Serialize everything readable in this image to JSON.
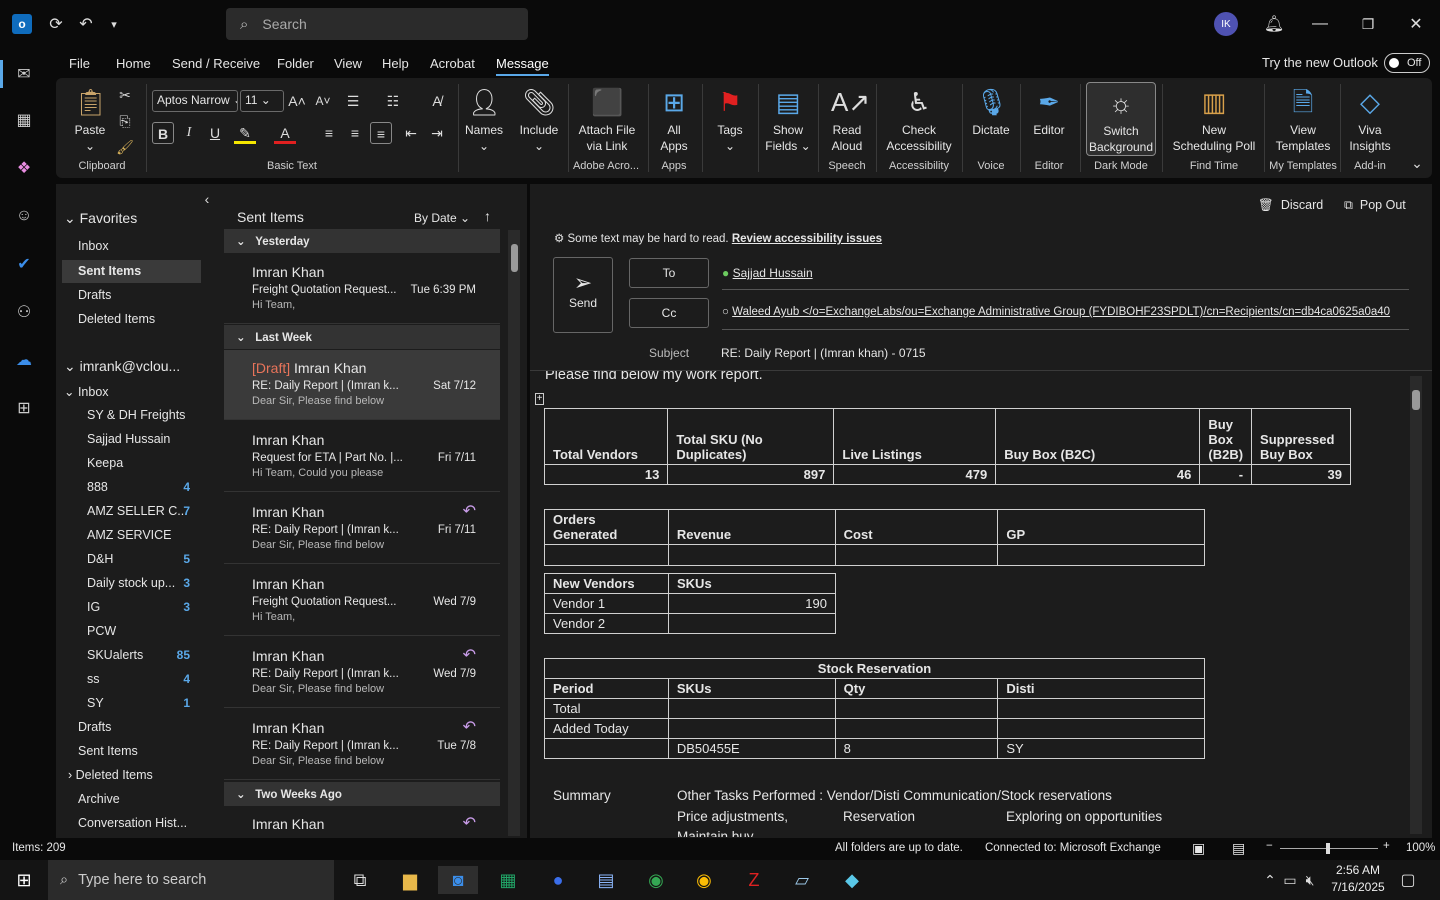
{
  "titlebar": {
    "search_placeholder": "Search",
    "avatar": "IK"
  },
  "menu": [
    "File",
    "Home",
    "Send / Receive",
    "Folder",
    "View",
    "Help",
    "Acrobat",
    "Message"
  ],
  "try_new": "Try the new Outlook",
  "toggle": "Off",
  "ribbon": {
    "paste": "Paste",
    "clipboard": "Clipboard",
    "font": "Aptos Narrow",
    "size": "11",
    "basic_text": "Basic Text",
    "names": "Names",
    "include": "Include",
    "attach1": "Attach File",
    "attach2": "via Link",
    "adobe": "Adobe Acro...",
    "allapps1": "All",
    "allapps2": "Apps",
    "apps": "Apps",
    "tags": "Tags",
    "showfields1": "Show",
    "showfields2": "Fields",
    "read1": "Read",
    "read2": "Aloud",
    "speech": "Speech",
    "check1": "Check",
    "check2": "Accessibility",
    "accessibility": "Accessibility",
    "dictate": "Dictate",
    "voice": "Voice",
    "editor": "Editor",
    "editor_grp": "Editor",
    "switch1": "Switch",
    "switch2": "Background",
    "darkmode": "Dark Mode",
    "poll1": "New",
    "poll2": "Scheduling Poll",
    "findtime": "Find Time",
    "tmpl1": "View",
    "tmpl2": "Templates",
    "mytemplates": "My Templates",
    "viva1": "Viva",
    "viva2": "Insights",
    "addin": "Add-in"
  },
  "folders": {
    "favorites": "Favorites",
    "fav": [
      "Inbox",
      "Sent Items",
      "Drafts",
      "Deleted Items"
    ],
    "account": "imrank@vclou...",
    "inbox": "Inbox",
    "sub": [
      {
        "n": "SY & DH Freights",
        "c": ""
      },
      {
        "n": "Sajjad Hussain",
        "c": ""
      },
      {
        "n": "Keepa",
        "c": ""
      },
      {
        "n": "888",
        "c": "4"
      },
      {
        "n": "AMZ SELLER C...",
        "c": "7"
      },
      {
        "n": "AMZ SERVICE",
        "c": ""
      },
      {
        "n": "D&H",
        "c": "5"
      },
      {
        "n": "Daily stock up...",
        "c": "3"
      },
      {
        "n": "IG",
        "c": "3"
      },
      {
        "n": "PCW",
        "c": ""
      },
      {
        "n": "SKUalerts",
        "c": "85"
      },
      {
        "n": "ss",
        "c": "4"
      },
      {
        "n": "SY",
        "c": "1"
      }
    ],
    "rest": [
      "Drafts",
      "Sent Items",
      "Deleted Items",
      "Archive",
      "Conversation Hist..."
    ]
  },
  "list": {
    "title": "Sent Items",
    "sort": "By Date",
    "groups": [
      "Yesterday",
      "Last Week",
      "Two Weeks Ago"
    ],
    "msgs": [
      {
        "draft": "",
        "name": "Imran Khan",
        "subj": "Freight Quotation Request...",
        "date": "Tue 6:39 PM",
        "prev": "Hi Team,"
      },
      {
        "draft": "[Draft]",
        "name": "Imran Khan",
        "subj": "RE:  Daily Report | (Imran k...",
        "date": "Sat 7/12",
        "prev": "Dear Sir,  Please find below"
      },
      {
        "draft": "",
        "name": "Imran Khan",
        "subj": "Request for ETA | Part No. |...",
        "date": "Fri 7/11",
        "prev": "Hi Team,  Could you please"
      },
      {
        "draft": "",
        "name": "Imran Khan",
        "subj": "RE:  Daily Report | (Imran k...",
        "date": "Fri 7/11",
        "prev": "Dear Sir,  Please find below"
      },
      {
        "draft": "",
        "name": "Imran Khan",
        "subj": "Freight Quotation Request...",
        "date": "Wed 7/9",
        "prev": "Hi Team,"
      },
      {
        "draft": "",
        "name": "Imran Khan",
        "subj": "RE:  Daily Report | (Imran k...",
        "date": "Wed 7/9",
        "prev": "Dear Sir,  Please find below"
      },
      {
        "draft": "",
        "name": "Imran Khan",
        "subj": "RE:  Daily Report | (Imran k...",
        "date": "Tue 7/8",
        "prev": "Dear Sir,  Please find below"
      },
      {
        "draft": "",
        "name": "Imran Khan",
        "subj": "",
        "date": "",
        "prev": ""
      }
    ]
  },
  "compose": {
    "discard": "Discard",
    "popout": "Pop Out",
    "warn": "Some text may be hard to read.",
    "warn_link": "Review accessibility issues",
    "send": "Send",
    "to": "To",
    "cc": "Cc",
    "to_val": "Sajjad Hussain",
    "cc_val": "Waleed Ayub </o=ExchangeLabs/ou=Exchange Administrative Group (FYDIBOHF23SPDLT)/cn=Recipients/cn=db4ca0625a0a40",
    "subject_lbl": "Subject",
    "subject": "RE:  Daily Report | (Imran khan) - 0715",
    "body_top": "Please find below my work report."
  },
  "t1": {
    "h": [
      "Total Vendors",
      "Total SKU (No Duplicates)",
      "Live Listings",
      "Buy Box (B2C)",
      "Buy Box (B2B)",
      "Suppressed Buy Box"
    ],
    "v": [
      "13",
      "897",
      "479",
      "46",
      "-",
      "39"
    ]
  },
  "t2": {
    "h": [
      "Orders Generated",
      "Revenue",
      "Cost",
      "GP"
    ]
  },
  "t3": {
    "h": [
      "New Vendors",
      "SKUs"
    ],
    "rows": [
      [
        "Vendor 1",
        "190"
      ],
      [
        "Vendor 2",
        ""
      ]
    ]
  },
  "t4": {
    "title": "Stock Reservation",
    "h": [
      "Period",
      "SKUs",
      "Qty",
      "Disti"
    ],
    "rows": [
      [
        "Total",
        "",
        "",
        ""
      ],
      [
        "Added Today",
        "",
        "",
        ""
      ],
      [
        "",
        "DB50455E",
        "8",
        "SY"
      ]
    ]
  },
  "summary": {
    "label": "Summary",
    "tasks": "Other Tasks Performed :  Vendor/Disti Communication/Stock reservations",
    "r2a": "Price adjustments,",
    "r2b": "Reservation",
    "r2c": "Exploring on opportunities",
    "r3": "Maintain buy"
  },
  "status": {
    "items": "Items: 209",
    "uptodate": "All folders are up to date.",
    "connected": "Connected to: Microsoft Exchange",
    "zoom": "100%"
  },
  "taskbar": {
    "search": "Type here to search",
    "time": "2:56 AM",
    "date": "7/16/2025"
  }
}
